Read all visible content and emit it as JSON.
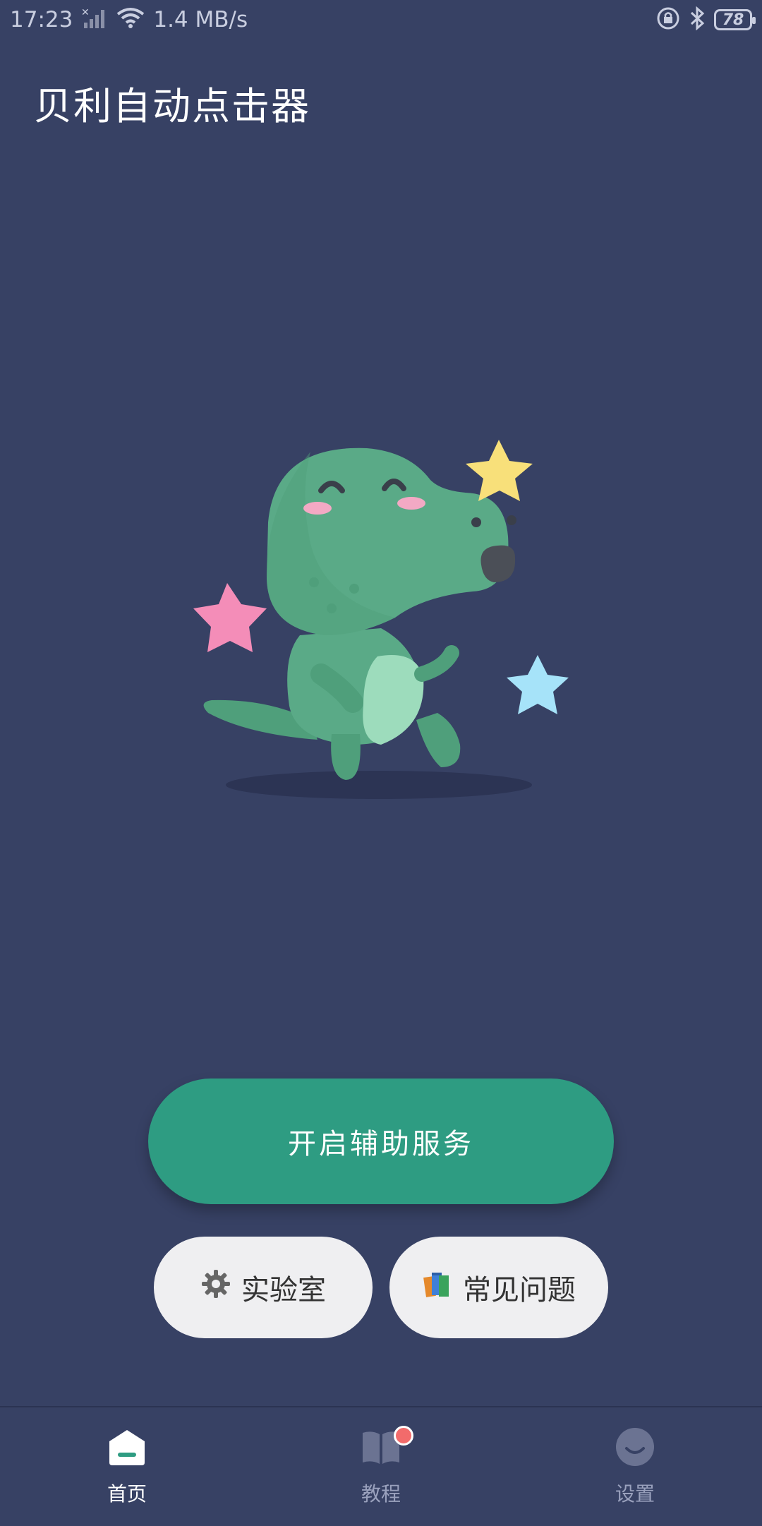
{
  "status_bar": {
    "time": "17:23",
    "network_speed": "1.4 MB/s",
    "battery_level": "78",
    "icons": [
      "signal-icon",
      "wifi-icon",
      "lock-rotation-icon",
      "bluetooth-icon",
      "battery-icon"
    ]
  },
  "app": {
    "title": "贝利自动点击器"
  },
  "main": {
    "primary_button_label": "开启辅助服务",
    "lab_button_label": "实验室",
    "faq_button_label": "常见问题"
  },
  "bottom_nav": {
    "items": [
      {
        "label": "首页",
        "icon": "home-icon",
        "active": true
      },
      {
        "label": "教程",
        "icon": "book-icon",
        "active": false,
        "badge": true
      },
      {
        "label": "设置",
        "icon": "smile-icon",
        "active": false
      }
    ]
  },
  "colors": {
    "background": "#374164",
    "primary": "#2e9c82",
    "pill_background": "#efeff1",
    "badge": "#f26b6b"
  }
}
